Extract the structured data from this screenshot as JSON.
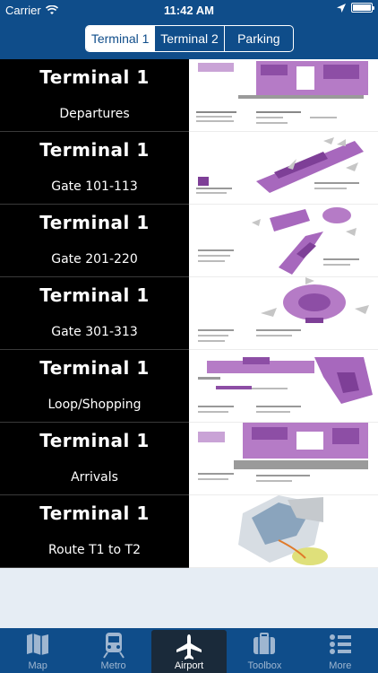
{
  "status_bar": {
    "carrier": "Carrier",
    "time": "11:42 AM"
  },
  "segments": [
    {
      "label": "Terminal 1",
      "active": true
    },
    {
      "label": "Terminal 2",
      "active": false
    },
    {
      "label": "Parking",
      "active": false
    }
  ],
  "rows": [
    {
      "title": "Terminal 1",
      "subtitle": "Departures"
    },
    {
      "title": "Terminal 1",
      "subtitle": "Gate 101-113"
    },
    {
      "title": "Terminal 1",
      "subtitle": "Gate 201-220"
    },
    {
      "title": "Terminal 1",
      "subtitle": "Gate 301-313"
    },
    {
      "title": "Terminal 1",
      "subtitle": "Loop/Shopping"
    },
    {
      "title": "Terminal 1",
      "subtitle": "Arrivals"
    },
    {
      "title": "Terminal 1",
      "subtitle": "Route T1 to T2"
    }
  ],
  "tabs": [
    {
      "label": "Map",
      "icon": "map-icon",
      "active": false
    },
    {
      "label": "Metro",
      "icon": "train-icon",
      "active": false
    },
    {
      "label": "Airport",
      "icon": "airplane-icon",
      "active": true
    },
    {
      "label": "Toolbox",
      "icon": "briefcase-icon",
      "active": false
    },
    {
      "label": "More",
      "icon": "list-icon",
      "active": false
    }
  ],
  "colors": {
    "nav_blue": "#0f4d8a",
    "map_purple": "#9b5fb0",
    "background": "#e6edf4"
  }
}
